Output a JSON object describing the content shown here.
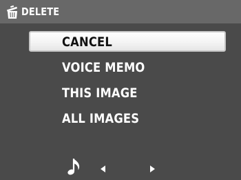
{
  "header": {
    "title": "DELETE",
    "icon": "trash-can-icon"
  },
  "menu": {
    "items": [
      {
        "label": "CANCEL",
        "selected": true
      },
      {
        "label": "VOICE MEMO",
        "selected": false
      },
      {
        "label": "THIS IMAGE",
        "selected": false
      },
      {
        "label": "ALL IMAGES",
        "selected": false
      }
    ]
  },
  "footer": {
    "icons": [
      "music-note-icon",
      "left-arrow-icon",
      "right-arrow-icon"
    ]
  },
  "colors": {
    "background": "#4a4a4a",
    "titlebar": "#686868",
    "selection": "#f4f4f4",
    "text": "#ffffff",
    "selected_text": "#111111"
  }
}
